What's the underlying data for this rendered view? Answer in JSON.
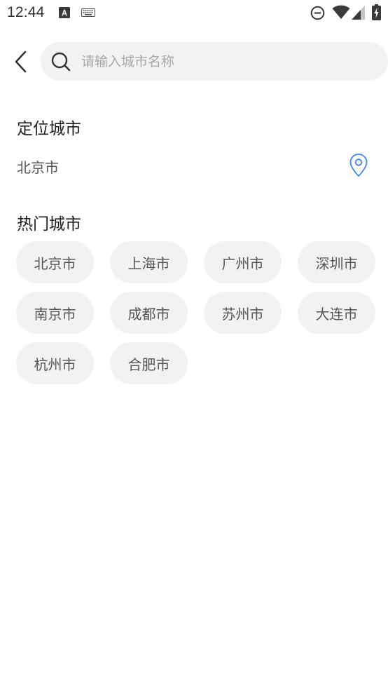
{
  "status_bar": {
    "time": "12:44",
    "left_icons": [
      "a-letter-notification-icon",
      "keyboard-icon"
    ],
    "right_icons": [
      "do-not-disturb-icon",
      "wifi-icon",
      "cellular-signal-icon",
      "battery-charging-icon"
    ]
  },
  "header": {
    "back_icon": "chevron-left-icon",
    "search_icon": "search-icon",
    "search_placeholder": "请输入城市名称",
    "search_value": ""
  },
  "location_section": {
    "title": "定位城市",
    "current_city": "北京市",
    "pin_icon": "location-pin-icon",
    "pin_color": "#3f86f5"
  },
  "hot_section": {
    "title": "热门城市",
    "cities": [
      "北京市",
      "上海市",
      "广州市",
      "深圳市",
      "南京市",
      "成都市",
      "苏州市",
      "大连市",
      "杭州市",
      "合肥市"
    ]
  }
}
